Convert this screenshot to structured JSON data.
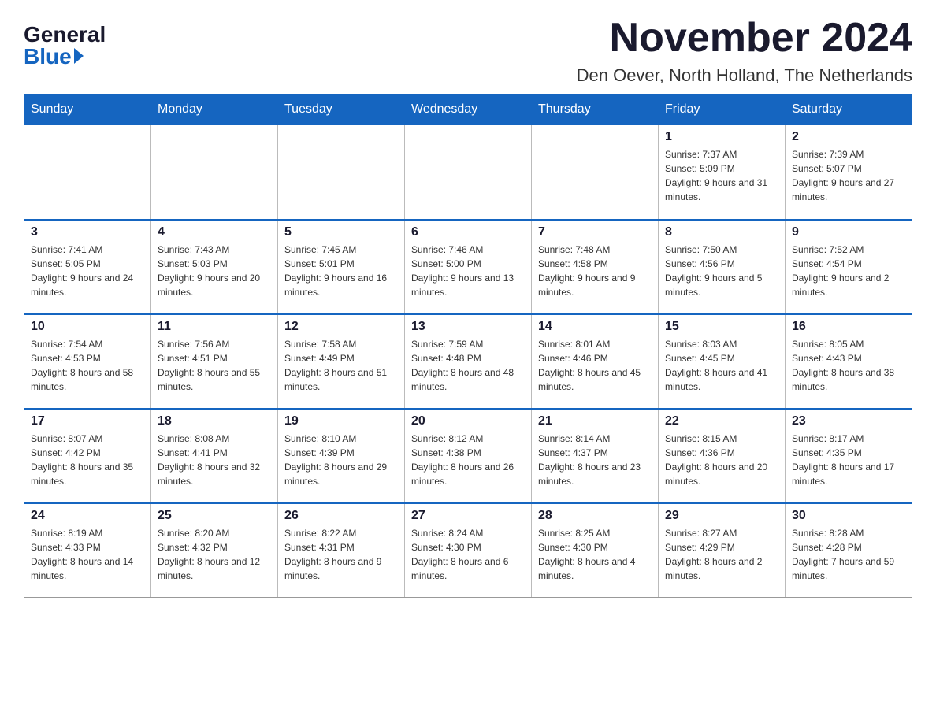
{
  "header": {
    "logo_general": "General",
    "logo_blue": "Blue",
    "month_title": "November 2024",
    "location": "Den Oever, North Holland, The Netherlands"
  },
  "weekdays": [
    "Sunday",
    "Monday",
    "Tuesday",
    "Wednesday",
    "Thursday",
    "Friday",
    "Saturday"
  ],
  "weeks": [
    [
      {
        "day": "",
        "sunrise": "",
        "sunset": "",
        "daylight": ""
      },
      {
        "day": "",
        "sunrise": "",
        "sunset": "",
        "daylight": ""
      },
      {
        "day": "",
        "sunrise": "",
        "sunset": "",
        "daylight": ""
      },
      {
        "day": "",
        "sunrise": "",
        "sunset": "",
        "daylight": ""
      },
      {
        "day": "",
        "sunrise": "",
        "sunset": "",
        "daylight": ""
      },
      {
        "day": "1",
        "sunrise": "Sunrise: 7:37 AM",
        "sunset": "Sunset: 5:09 PM",
        "daylight": "Daylight: 9 hours and 31 minutes."
      },
      {
        "day": "2",
        "sunrise": "Sunrise: 7:39 AM",
        "sunset": "Sunset: 5:07 PM",
        "daylight": "Daylight: 9 hours and 27 minutes."
      }
    ],
    [
      {
        "day": "3",
        "sunrise": "Sunrise: 7:41 AM",
        "sunset": "Sunset: 5:05 PM",
        "daylight": "Daylight: 9 hours and 24 minutes."
      },
      {
        "day": "4",
        "sunrise": "Sunrise: 7:43 AM",
        "sunset": "Sunset: 5:03 PM",
        "daylight": "Daylight: 9 hours and 20 minutes."
      },
      {
        "day": "5",
        "sunrise": "Sunrise: 7:45 AM",
        "sunset": "Sunset: 5:01 PM",
        "daylight": "Daylight: 9 hours and 16 minutes."
      },
      {
        "day": "6",
        "sunrise": "Sunrise: 7:46 AM",
        "sunset": "Sunset: 5:00 PM",
        "daylight": "Daylight: 9 hours and 13 minutes."
      },
      {
        "day": "7",
        "sunrise": "Sunrise: 7:48 AM",
        "sunset": "Sunset: 4:58 PM",
        "daylight": "Daylight: 9 hours and 9 minutes."
      },
      {
        "day": "8",
        "sunrise": "Sunrise: 7:50 AM",
        "sunset": "Sunset: 4:56 PM",
        "daylight": "Daylight: 9 hours and 5 minutes."
      },
      {
        "day": "9",
        "sunrise": "Sunrise: 7:52 AM",
        "sunset": "Sunset: 4:54 PM",
        "daylight": "Daylight: 9 hours and 2 minutes."
      }
    ],
    [
      {
        "day": "10",
        "sunrise": "Sunrise: 7:54 AM",
        "sunset": "Sunset: 4:53 PM",
        "daylight": "Daylight: 8 hours and 58 minutes."
      },
      {
        "day": "11",
        "sunrise": "Sunrise: 7:56 AM",
        "sunset": "Sunset: 4:51 PM",
        "daylight": "Daylight: 8 hours and 55 minutes."
      },
      {
        "day": "12",
        "sunrise": "Sunrise: 7:58 AM",
        "sunset": "Sunset: 4:49 PM",
        "daylight": "Daylight: 8 hours and 51 minutes."
      },
      {
        "day": "13",
        "sunrise": "Sunrise: 7:59 AM",
        "sunset": "Sunset: 4:48 PM",
        "daylight": "Daylight: 8 hours and 48 minutes."
      },
      {
        "day": "14",
        "sunrise": "Sunrise: 8:01 AM",
        "sunset": "Sunset: 4:46 PM",
        "daylight": "Daylight: 8 hours and 45 minutes."
      },
      {
        "day": "15",
        "sunrise": "Sunrise: 8:03 AM",
        "sunset": "Sunset: 4:45 PM",
        "daylight": "Daylight: 8 hours and 41 minutes."
      },
      {
        "day": "16",
        "sunrise": "Sunrise: 8:05 AM",
        "sunset": "Sunset: 4:43 PM",
        "daylight": "Daylight: 8 hours and 38 minutes."
      }
    ],
    [
      {
        "day": "17",
        "sunrise": "Sunrise: 8:07 AM",
        "sunset": "Sunset: 4:42 PM",
        "daylight": "Daylight: 8 hours and 35 minutes."
      },
      {
        "day": "18",
        "sunrise": "Sunrise: 8:08 AM",
        "sunset": "Sunset: 4:41 PM",
        "daylight": "Daylight: 8 hours and 32 minutes."
      },
      {
        "day": "19",
        "sunrise": "Sunrise: 8:10 AM",
        "sunset": "Sunset: 4:39 PM",
        "daylight": "Daylight: 8 hours and 29 minutes."
      },
      {
        "day": "20",
        "sunrise": "Sunrise: 8:12 AM",
        "sunset": "Sunset: 4:38 PM",
        "daylight": "Daylight: 8 hours and 26 minutes."
      },
      {
        "day": "21",
        "sunrise": "Sunrise: 8:14 AM",
        "sunset": "Sunset: 4:37 PM",
        "daylight": "Daylight: 8 hours and 23 minutes."
      },
      {
        "day": "22",
        "sunrise": "Sunrise: 8:15 AM",
        "sunset": "Sunset: 4:36 PM",
        "daylight": "Daylight: 8 hours and 20 minutes."
      },
      {
        "day": "23",
        "sunrise": "Sunrise: 8:17 AM",
        "sunset": "Sunset: 4:35 PM",
        "daylight": "Daylight: 8 hours and 17 minutes."
      }
    ],
    [
      {
        "day": "24",
        "sunrise": "Sunrise: 8:19 AM",
        "sunset": "Sunset: 4:33 PM",
        "daylight": "Daylight: 8 hours and 14 minutes."
      },
      {
        "day": "25",
        "sunrise": "Sunrise: 8:20 AM",
        "sunset": "Sunset: 4:32 PM",
        "daylight": "Daylight: 8 hours and 12 minutes."
      },
      {
        "day": "26",
        "sunrise": "Sunrise: 8:22 AM",
        "sunset": "Sunset: 4:31 PM",
        "daylight": "Daylight: 8 hours and 9 minutes."
      },
      {
        "day": "27",
        "sunrise": "Sunrise: 8:24 AM",
        "sunset": "Sunset: 4:30 PM",
        "daylight": "Daylight: 8 hours and 6 minutes."
      },
      {
        "day": "28",
        "sunrise": "Sunrise: 8:25 AM",
        "sunset": "Sunset: 4:30 PM",
        "daylight": "Daylight: 8 hours and 4 minutes."
      },
      {
        "day": "29",
        "sunrise": "Sunrise: 8:27 AM",
        "sunset": "Sunset: 4:29 PM",
        "daylight": "Daylight: 8 hours and 2 minutes."
      },
      {
        "day": "30",
        "sunrise": "Sunrise: 8:28 AM",
        "sunset": "Sunset: 4:28 PM",
        "daylight": "Daylight: 7 hours and 59 minutes."
      }
    ]
  ]
}
